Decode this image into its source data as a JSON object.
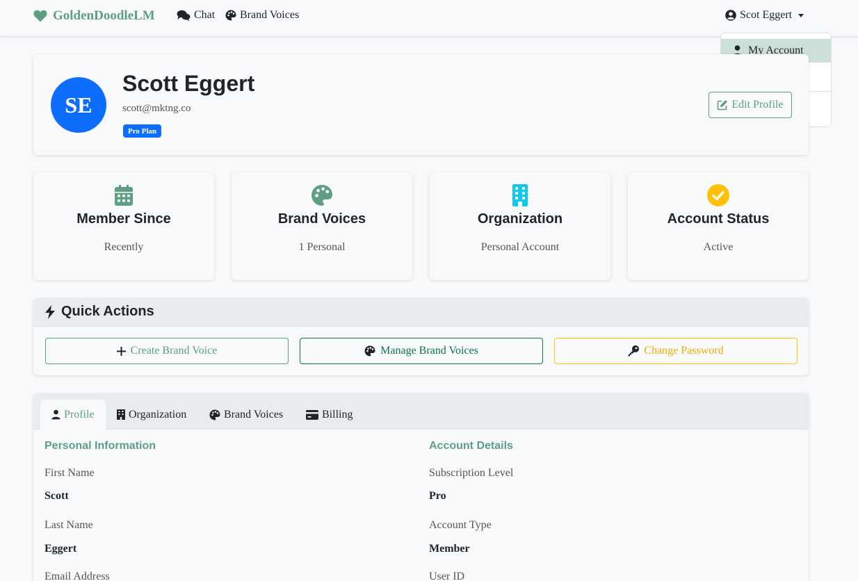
{
  "navbar": {
    "brand": "GoldenDoodleLM",
    "links": [
      "Chat",
      "Brand Voices"
    ],
    "user": "Scot Eggert",
    "dropdown": {
      "active_item": "My Account"
    }
  },
  "profile": {
    "initials": "SE",
    "name": "Scott Eggert",
    "email": "scott@mktng.co",
    "plan_badge": "Pro Plan",
    "edit_label": "Edit Profile"
  },
  "stats": [
    {
      "title": "Member Since",
      "value": "Recently",
      "icon": "calendar-icon",
      "color": "#5e9e83"
    },
    {
      "title": "Brand Voices",
      "value": "1 Personal",
      "icon": "palette-icon",
      "color": "#5e9e83"
    },
    {
      "title": "Organization",
      "value": "Personal Account",
      "icon": "building-icon",
      "color": "#0dcaf0"
    },
    {
      "title": "Account Status",
      "value": "Active",
      "icon": "check-circle-icon",
      "color": "#ffc107"
    }
  ],
  "quick_actions": {
    "title": "Quick Actions",
    "buttons": [
      "Create Brand Voice",
      "Manage Brand Voices",
      "Change Password"
    ]
  },
  "tabs": [
    "Profile",
    "Organization",
    "Brand Voices",
    "Billing"
  ],
  "personal": {
    "title": "Personal Information",
    "fields": [
      {
        "label": "First Name",
        "value": "Scott"
      },
      {
        "label": "Last Name",
        "value": "Eggert"
      },
      {
        "label": "Email Address",
        "value": ""
      }
    ]
  },
  "account": {
    "title": "Account Details",
    "fields": [
      {
        "label": "Subscription Level",
        "value": "Pro"
      },
      {
        "label": "Account Type",
        "value": "Member"
      },
      {
        "label": "User ID",
        "value": ""
      }
    ]
  }
}
